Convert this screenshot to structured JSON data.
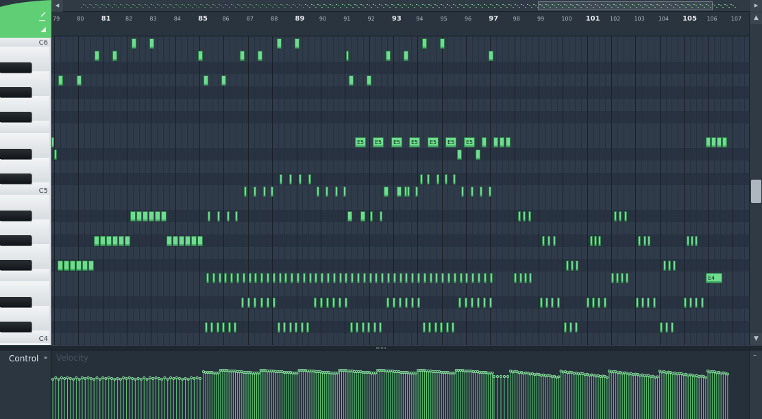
{
  "overview": {
    "left_arrow": "◂",
    "right_arrow": "▸"
  },
  "ruler": {
    "bars": [
      "79",
      "80",
      "81",
      "82",
      "83",
      "84",
      "85",
      "86",
      "87",
      "88",
      "89",
      "90",
      "91",
      "92",
      "93",
      "94",
      "95",
      "96",
      "97",
      "98",
      "99",
      "100",
      "101",
      "102",
      "103",
      "104",
      "105",
      "106",
      "107"
    ],
    "major_bars": [
      "81",
      "85",
      "89",
      "93",
      "97",
      "101",
      "105"
    ]
  },
  "piano": {
    "labels": {
      "c6": "C6",
      "c5": "C5",
      "c4": "C4"
    }
  },
  "note_labels": {
    "e5": "E5",
    "e4": "E4"
  },
  "control": {
    "label": "Control",
    "arrow": "▸",
    "target": "Velocity"
  },
  "scrollbar": {
    "up": "▲",
    "down": "▼",
    "pane_minus": "–"
  },
  "colors": {
    "note": "#6fdc8f",
    "accent": "#59c26f",
    "grid_bg": "#2c3845"
  }
}
